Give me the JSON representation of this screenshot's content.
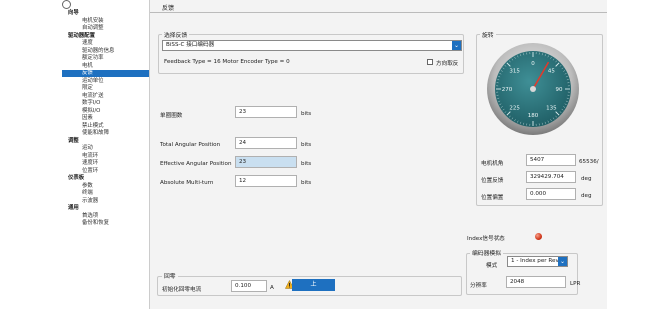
{
  "tree": {
    "items": [
      {
        "label": "向导",
        "kind": "cat"
      },
      {
        "label": "电机安装",
        "kind": "sub"
      },
      {
        "label": "自动调整",
        "kind": "sub"
      },
      {
        "label": "驱动器配置",
        "kind": "cat"
      },
      {
        "label": "速度",
        "kind": "sub"
      },
      {
        "label": "驱动器的信息",
        "kind": "sub"
      },
      {
        "label": "额定功率",
        "kind": "sub"
      },
      {
        "label": "电机",
        "kind": "sub"
      },
      {
        "label": "反馈",
        "kind": "sub",
        "selected": true
      },
      {
        "label": "运动单位",
        "kind": "sub"
      },
      {
        "label": "限定",
        "kind": "sub"
      },
      {
        "label": "电流扩送",
        "kind": "sub"
      },
      {
        "label": "数字I/O",
        "kind": "sub"
      },
      {
        "label": "模拟I/O",
        "kind": "sub"
      },
      {
        "label": "因素",
        "kind": "sub"
      },
      {
        "label": "禁止模式",
        "kind": "sub"
      },
      {
        "label": "使能和故障",
        "kind": "sub"
      },
      {
        "label": "调整",
        "kind": "cat"
      },
      {
        "label": "运动",
        "kind": "sub"
      },
      {
        "label": "电流环",
        "kind": "sub"
      },
      {
        "label": "速度环",
        "kind": "sub"
      },
      {
        "label": "位置环",
        "kind": "sub"
      },
      {
        "label": "仪表板",
        "kind": "cat"
      },
      {
        "label": "参数",
        "kind": "sub"
      },
      {
        "label": "终端",
        "kind": "sub"
      },
      {
        "label": "示波器",
        "kind": "sub"
      },
      {
        "label": "通用",
        "kind": "cat"
      },
      {
        "label": "首选项",
        "kind": "sub"
      },
      {
        "label": "备份和恢复",
        "kind": "sub"
      }
    ]
  },
  "panel_title": "反馈",
  "feedback_select": {
    "title": "选择反馈",
    "selected": "BiSS-C 接口编码器",
    "info": "Feedback Type = 16   Motor Encoder Type = 0",
    "dir_label": "方向取反"
  },
  "fields": {
    "single_turn": {
      "label": "单圈圈数",
      "value": "23",
      "unit": "bits"
    },
    "total_angular": {
      "label": "Total Angular Position",
      "value": "24",
      "unit": "bits"
    },
    "effective_angular": {
      "label": "Effective Angular Position",
      "value": "23",
      "unit": "bits"
    },
    "absolute_multi": {
      "label": "Absolute Multi-turn",
      "value": "12",
      "unit": "bits"
    }
  },
  "rotation": {
    "title": "旋转",
    "gauge_ticks": [
      "0",
      "45",
      "90",
      "135",
      "180",
      "225",
      "270",
      "315"
    ],
    "gauge_value_deg": 30,
    "motor_angle": {
      "label": "电机机角",
      "value": "5407",
      "unit": "65536/"
    },
    "pos_feedback": {
      "label": "位置反馈",
      "value": "329429.704",
      "unit": "deg"
    },
    "pos_offset": {
      "label": "位置偏置",
      "value": "0.000",
      "unit": "deg"
    }
  },
  "index": {
    "label": "Index信号状态"
  },
  "encoder_sim": {
    "title": "编码器模拟",
    "mode_label": "模式",
    "mode_value": "1 - Index per Rev",
    "resolution_label": "分辨率",
    "resolution_value": "2048",
    "resolution_unit": "LPR"
  },
  "zero": {
    "title": "回零",
    "current_label": "初始化回零电流",
    "current_value": "0.100",
    "current_unit": "A",
    "button_label": "上"
  }
}
